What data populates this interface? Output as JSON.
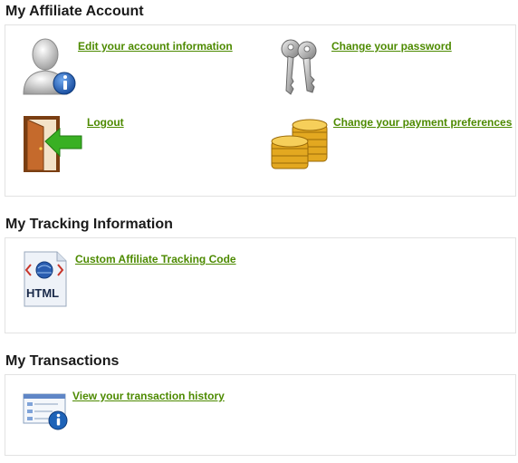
{
  "sections": [
    {
      "title": "My Affiliate Account",
      "items": [
        {
          "label": "Edit your account information",
          "icon": "user-info-icon"
        },
        {
          "label": "Change your password",
          "icon": "keys-icon"
        },
        {
          "label": "Logout",
          "icon": "logout-door-icon"
        },
        {
          "label": "Change your payment preferences",
          "icon": "gold-coins-icon"
        }
      ]
    },
    {
      "title": "My Tracking Information",
      "items": [
        {
          "label": "Custom Affiliate Tracking Code",
          "icon": "html-document-icon",
          "icon_text": "HTML"
        }
      ]
    },
    {
      "title": "My Transactions",
      "items": [
        {
          "label": "View your transaction history",
          "icon": "transaction-info-icon"
        }
      ]
    }
  ],
  "colors": {
    "link": "#4d8a00",
    "info_badge": "#1e63b8",
    "coin": "#e3a820",
    "arrow": "#39b023",
    "door": "#b8642a"
  }
}
